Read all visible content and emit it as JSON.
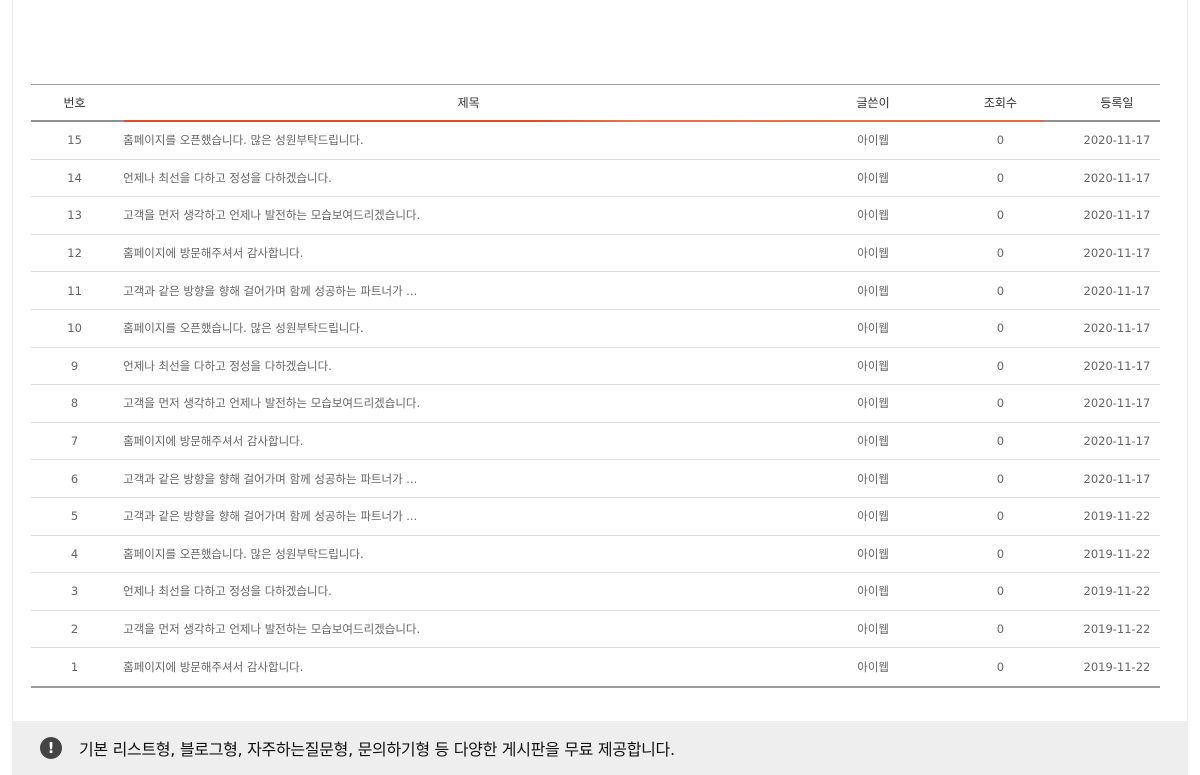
{
  "table": {
    "headers": {
      "no": "번호",
      "title": "제목",
      "writer": "글쓴이",
      "views": "조회수",
      "date": "등록일"
    },
    "rows": [
      {
        "no": "15",
        "title": "홈페이지를 오픈했습니다. 많은 성원부탁드립니다.",
        "writer": "아이웹",
        "views": "0",
        "date": "2020-11-17"
      },
      {
        "no": "14",
        "title": "언제나 최선을 다하고 정성을 다하겠습니다.",
        "writer": "아이웹",
        "views": "0",
        "date": "2020-11-17"
      },
      {
        "no": "13",
        "title": "고객을 먼저 생각하고 언제나 발전하는 모습보여드리겠습니다.",
        "writer": "아이웹",
        "views": "0",
        "date": "2020-11-17"
      },
      {
        "no": "12",
        "title": "홈페이지에 방문해주셔서 감사합니다.",
        "writer": "아이웹",
        "views": "0",
        "date": "2020-11-17"
      },
      {
        "no": "11",
        "title": "고객과 같은 방향을 향해 걸어가며 함께 성공하는 파트너가 ...",
        "writer": "아이웹",
        "views": "0",
        "date": "2020-11-17"
      },
      {
        "no": "10",
        "title": "홈페이지를 오픈했습니다. 많은 성원부탁드립니다.",
        "writer": "아이웹",
        "views": "0",
        "date": "2020-11-17"
      },
      {
        "no": "9",
        "title": "언제나 최선을 다하고 정성을 다하겠습니다.",
        "writer": "아이웹",
        "views": "0",
        "date": "2020-11-17"
      },
      {
        "no": "8",
        "title": "고객을 먼저 생각하고 언제나 발전하는 모습보여드리겠습니다.",
        "writer": "아이웹",
        "views": "0",
        "date": "2020-11-17"
      },
      {
        "no": "7",
        "title": "홈페이지에 방문해주셔서 감사합니다.",
        "writer": "아이웹",
        "views": "0",
        "date": "2020-11-17"
      },
      {
        "no": "6",
        "title": "고객과 같은 방향을 향해 걸어가며 함께 성공하는 파트너가 ...",
        "writer": "아이웹",
        "views": "0",
        "date": "2020-11-17"
      },
      {
        "no": "5",
        "title": "고객과 같은 방향을 향해 걸어가며 함께 성공하는 파트너가 ...",
        "writer": "아이웹",
        "views": "0",
        "date": "2019-11-22"
      },
      {
        "no": "4",
        "title": "홈페이지를 오픈했습니다. 많은 성원부탁드립니다.",
        "writer": "아이웹",
        "views": "0",
        "date": "2019-11-22"
      },
      {
        "no": "3",
        "title": "언제나 최선을 다하고 정성을 다하겠습니다.",
        "writer": "아이웹",
        "views": "0",
        "date": "2019-11-22"
      },
      {
        "no": "2",
        "title": "고객을 먼저 생각하고 언제나 발전하는 모습보여드리겠습니다.",
        "writer": "아이웹",
        "views": "0",
        "date": "2019-11-22"
      },
      {
        "no": "1",
        "title": "홈페이지에 방문해주셔서 감사합니다.",
        "writer": "아이웹",
        "views": "0",
        "date": "2019-11-22"
      }
    ]
  },
  "notice": {
    "icon": "exclamation-icon",
    "text": "기본 리스트형, 블로그형, 자주하는질문형, 문의하기형 등 다양한 게시판을 무료 제공합니다."
  },
  "colors": {
    "accent": "#e44c2d",
    "notice_bg": "#eeeeee"
  }
}
